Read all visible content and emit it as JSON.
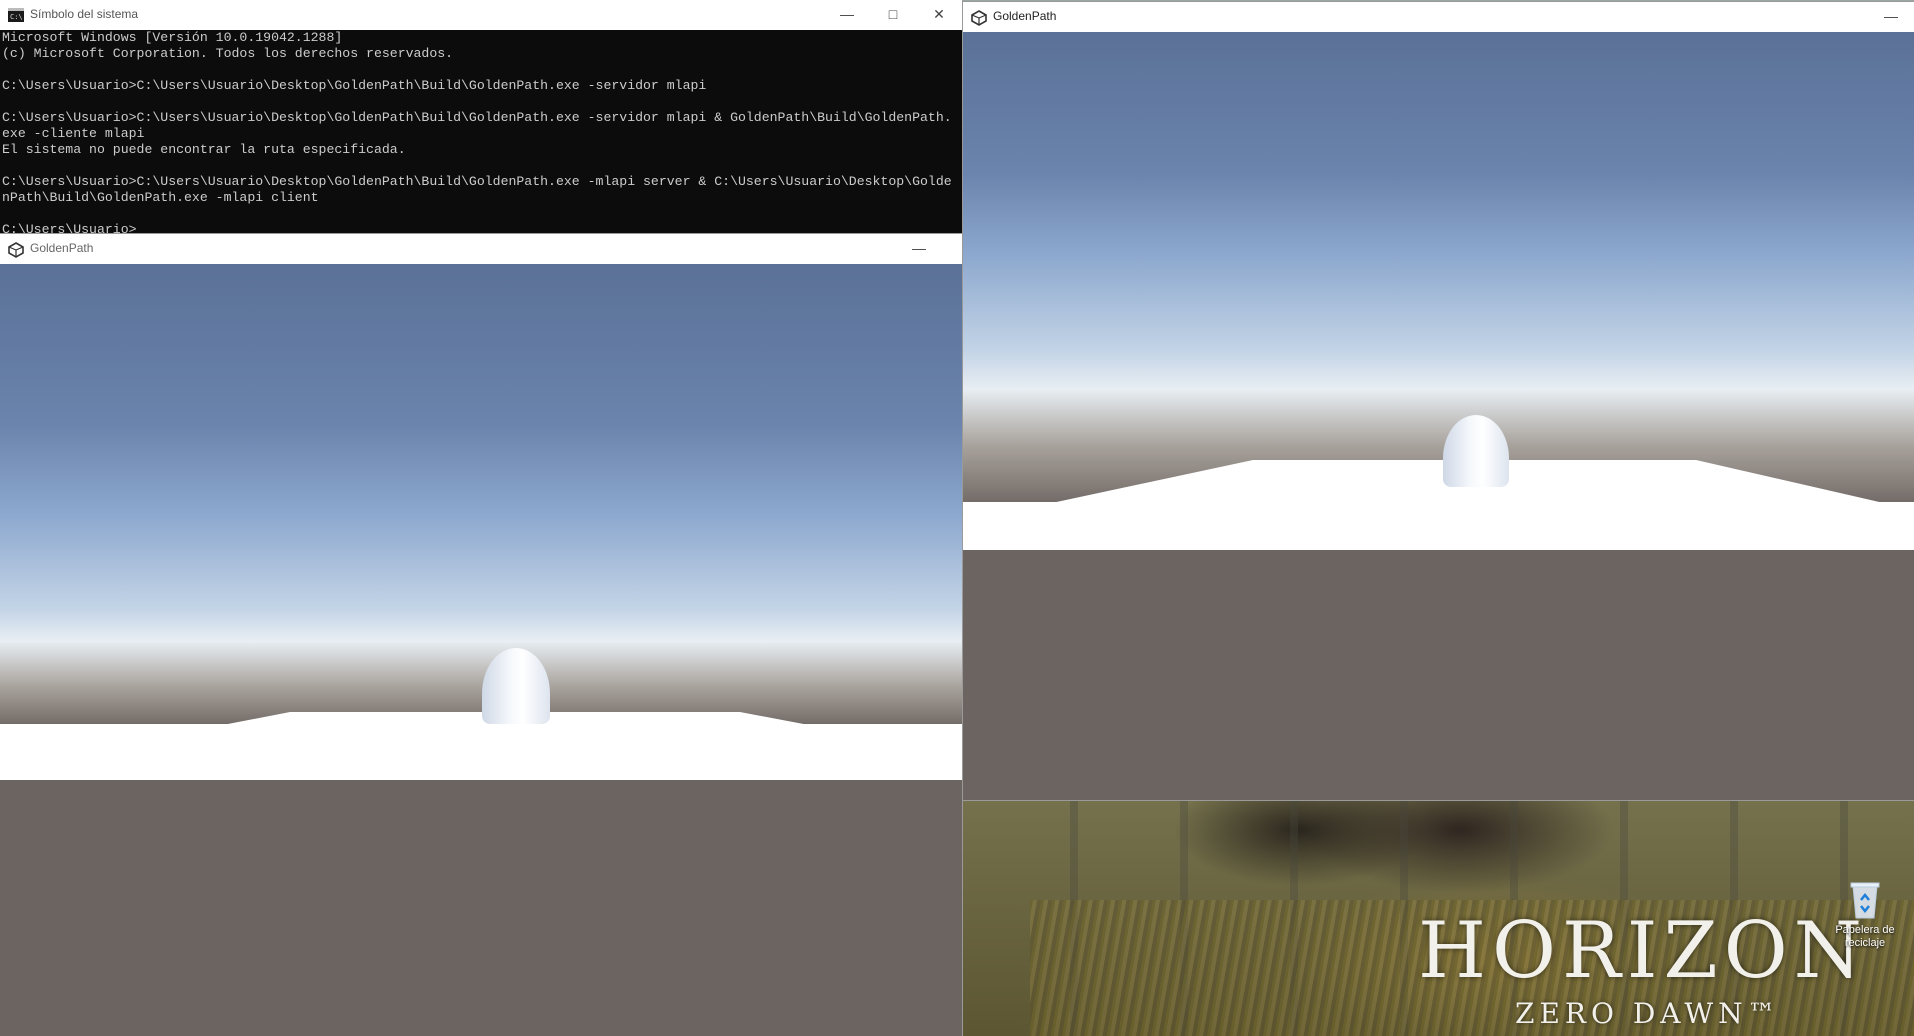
{
  "console_window": {
    "title": "Símbolo del sistema",
    "lines": [
      "Microsoft Windows [Versión 10.0.19042.1288]",
      "(c) Microsoft Corporation. Todos los derechos reservados.",
      "",
      "C:\\Users\\Usuario>C:\\Users\\Usuario\\Desktop\\GoldenPath\\Build\\GoldenPath.exe -servidor mlapi",
      "",
      "C:\\Users\\Usuario>C:\\Users\\Usuario\\Desktop\\GoldenPath\\Build\\GoldenPath.exe -servidor mlapi & GoldenPath\\Build\\GoldenPath.",
      "exe -cliente mlapi",
      "El sistema no puede encontrar la ruta especificada.",
      "",
      "C:\\Users\\Usuario>C:\\Users\\Usuario\\Desktop\\GoldenPath\\Build\\GoldenPath.exe -mlapi server & C:\\Users\\Usuario\\Desktop\\Golde",
      "nPath\\Build\\GoldenPath.exe -mlapi client",
      "",
      "C:\\Users\\Usuario>"
    ]
  },
  "game_window_left": {
    "title": "GoldenPath"
  },
  "game_window_right": {
    "title": "GoldenPath"
  },
  "desktop": {
    "recycle_bin_label": "Papelera de reciclaje",
    "wallpaper_title": "HORIZON",
    "wallpaper_subtitle": "ZERO DAWN™"
  },
  "colors": {
    "sky_top": "#5a7198",
    "sky_horizon": "#dce6ee",
    "ground": "#6b6460",
    "console_bg": "#0c0c0c",
    "console_text": "#cccccc"
  },
  "icons": [
    "cmd-icon",
    "unity-icon",
    "minimize-icon",
    "maximize-icon",
    "close-icon",
    "recycle-bin-icon"
  ]
}
